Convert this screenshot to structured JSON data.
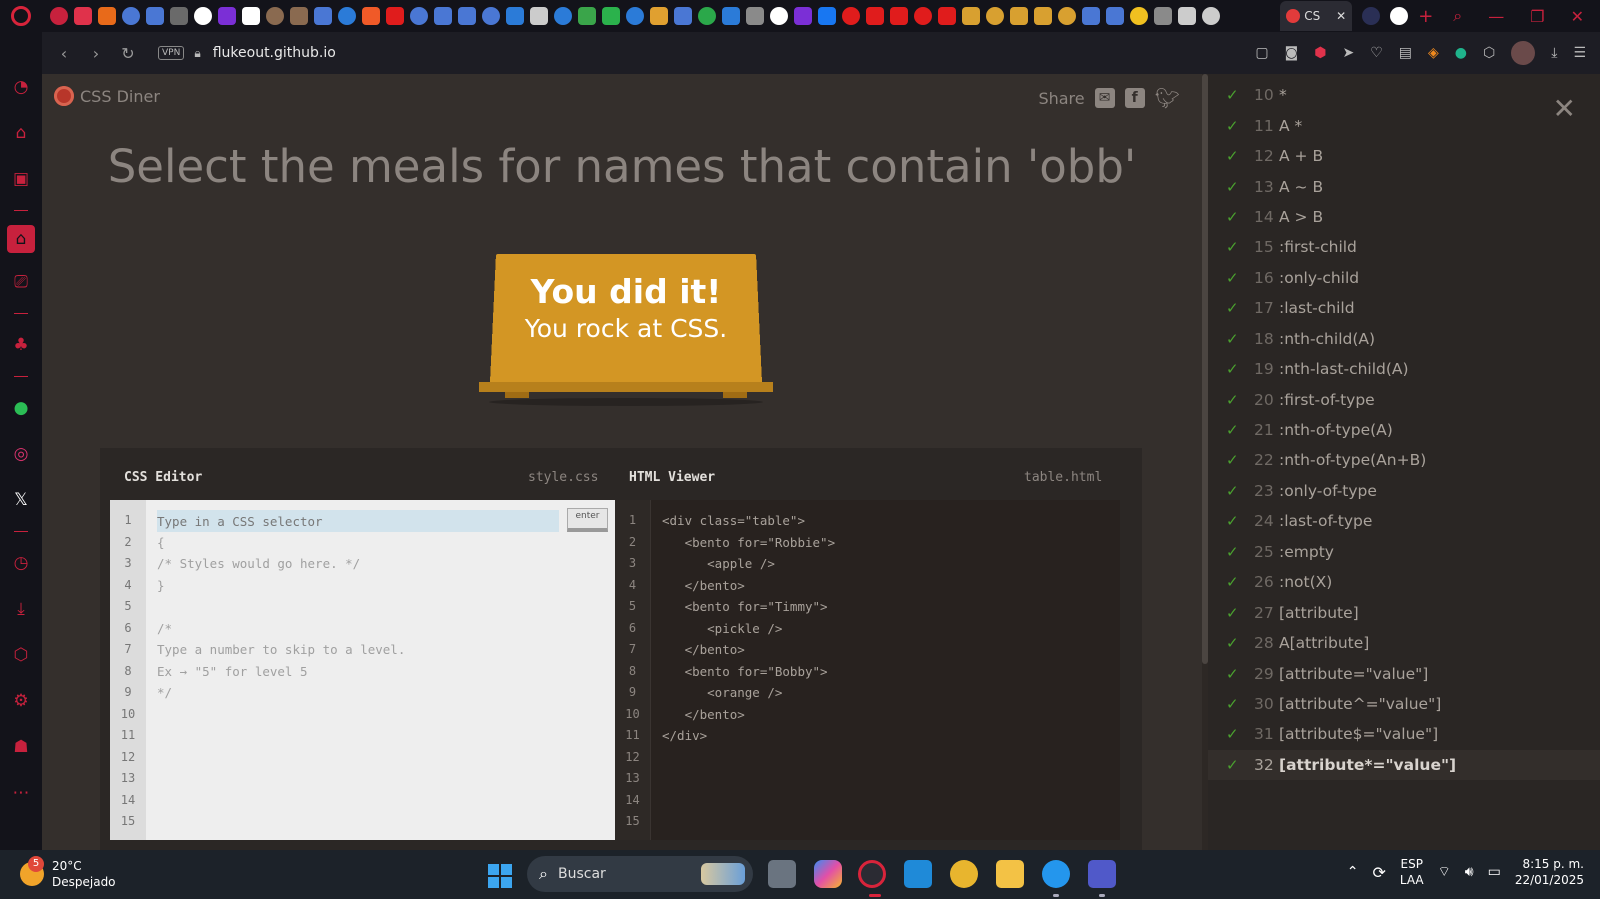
{
  "browser": {
    "active_tab_title": "CS",
    "url": "flukeout.github.io",
    "vpn_label": "VPN"
  },
  "page": {
    "logo_text": "CSS Diner",
    "share_label": "Share",
    "order_instruction": "Select the meals for names that contain 'obb'",
    "win_line1": "You did it!",
    "win_line2": "You rock at CSS."
  },
  "css_editor": {
    "title": "CSS Editor",
    "filename": "style.css",
    "input_placeholder": "Type in a CSS selector",
    "enter_label": "enter",
    "line_numbers": [
      "1",
      "2",
      "3",
      "4",
      "5",
      "6",
      "7",
      "8",
      "9",
      "10",
      "11",
      "12",
      "13",
      "14",
      "15"
    ],
    "lines": [
      "",
      "{",
      "/* Styles would go here. */",
      "}",
      "",
      "/*",
      "Type a number to skip to a level.",
      "Ex → \"5\" for level 5",
      "*/"
    ]
  },
  "html_viewer": {
    "title": "HTML Viewer",
    "filename": "table.html",
    "line_numbers": [
      "1",
      "2",
      "3",
      "4",
      "5",
      "6",
      "7",
      "8",
      "9",
      "10",
      "11",
      "12",
      "13",
      "14",
      "15"
    ],
    "lines": [
      "<div class=\"table\">",
      "   <bento for=\"Robbie\">",
      "      <apple />",
      "   </bento>",
      "   <bento for=\"Timmy\">",
      "      <pickle />",
      "   </bento>",
      "   <bento for=\"Bobby\">",
      "      <orange />",
      "   </bento>",
      "</div>"
    ]
  },
  "levels": {
    "check_glyph": "✓",
    "current_level": "32",
    "items": [
      {
        "num": "10",
        "name": "*"
      },
      {
        "num": "11",
        "name": "A *"
      },
      {
        "num": "12",
        "name": "A + B"
      },
      {
        "num": "13",
        "name": "A ~ B"
      },
      {
        "num": "14",
        "name": "A > B"
      },
      {
        "num": "15",
        "name": ":first-child"
      },
      {
        "num": "16",
        "name": ":only-child"
      },
      {
        "num": "17",
        "name": ":last-child"
      },
      {
        "num": "18",
        "name": ":nth-child(A)"
      },
      {
        "num": "19",
        "name": ":nth-last-child(A)"
      },
      {
        "num": "20",
        "name": ":first-of-type"
      },
      {
        "num": "21",
        "name": ":nth-of-type(A)"
      },
      {
        "num": "22",
        "name": ":nth-of-type(An+B)"
      },
      {
        "num": "23",
        "name": ":only-of-type"
      },
      {
        "num": "24",
        "name": ":last-of-type"
      },
      {
        "num": "25",
        "name": ":empty"
      },
      {
        "num": "26",
        "name": ":not(X)"
      },
      {
        "num": "27",
        "name": "[attribute]"
      },
      {
        "num": "28",
        "name": "A[attribute]"
      },
      {
        "num": "29",
        "name": "[attribute=\"value\"]"
      },
      {
        "num": "30",
        "name": "[attribute^=\"value\"]"
      },
      {
        "num": "31",
        "name": "[attribute$=\"value\"]"
      },
      {
        "num": "32",
        "name": "[attribute*=\"value\"]"
      }
    ]
  },
  "taskbar": {
    "weather_temp": "20°C",
    "weather_desc": "Despejado",
    "weather_badge": "5",
    "search_placeholder": "Buscar",
    "lang_line1": "ESP",
    "lang_line2": "LAA",
    "time": "8:15 p. m.",
    "date": "22/01/2025"
  },
  "colors": {
    "page_bg": "#342f2c",
    "table_gold": "#d39624",
    "check_green": "#4aa02f",
    "opera_red": "#c7213d"
  }
}
